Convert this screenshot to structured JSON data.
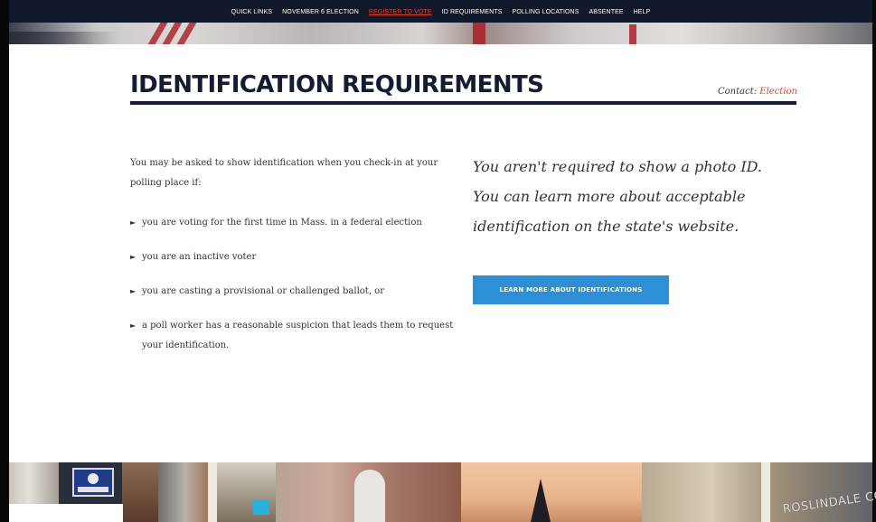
{
  "nav": {
    "items": [
      {
        "label": "QUICK LINKS",
        "active": false
      },
      {
        "label": "NOVEMBER 6 ELECTION",
        "active": false
      },
      {
        "label": "REGISTER TO VOTE",
        "active": true
      },
      {
        "label": "ID REQUIREMENTS",
        "active": false
      },
      {
        "label": "POLLING LOCATIONS",
        "active": false
      },
      {
        "label": "ABSENTEE",
        "active": false
      },
      {
        "label": "HELP",
        "active": false
      }
    ],
    "background_color": "#10182b",
    "active_color": "#e0452f"
  },
  "page": {
    "title": "IDENTIFICATION REQUIREMENTS",
    "contact_label": "Contact:",
    "contact_link": "Election"
  },
  "content": {
    "intro": "You may be asked to show identification when you check-in at your polling place if:",
    "bullets": [
      "you are voting for the first time in Mass. in a federal election",
      "you are an inactive voter",
      "you are casting a provisional or challenged ballot, or",
      "a poll worker has a reasonable suspicion that leads them to request your identification."
    ],
    "bullet_marker": "►",
    "callout": "You aren't required to show a photo ID. You can learn more about acceptable identification on the state's website.",
    "button_label": "LEARN MORE ABOUT IDENTIFICATIONS",
    "button_color": "#2d8fd6"
  },
  "footer_photos": {
    "sign_text": "ROSLINDALE CO"
  }
}
